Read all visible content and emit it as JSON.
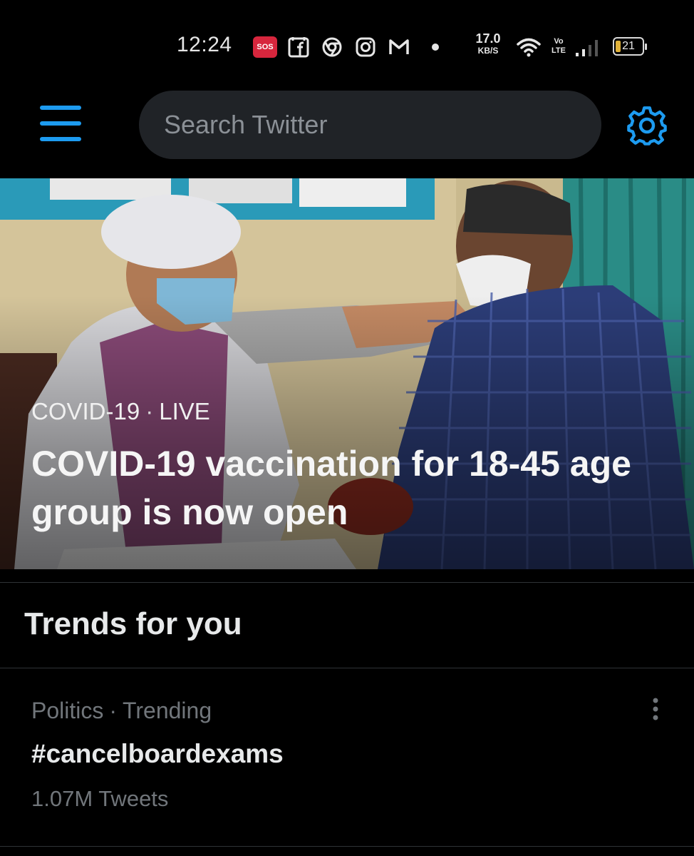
{
  "status_bar": {
    "time": "12:24",
    "sos": "SOS",
    "net_speed_value": "17.0",
    "net_speed_unit": "KB/S",
    "volte_top": "Vo",
    "volte_bottom": "LTE",
    "battery": "21",
    "icons": [
      "sos-icon",
      "facebook-icon",
      "chrome-icon",
      "instagram-icon",
      "gmail-icon",
      "dot-icon",
      "wifi-icon",
      "volte-icon",
      "signal-icon",
      "battery-icon"
    ]
  },
  "header": {
    "search_placeholder": "Search Twitter",
    "menu_icon": "hamburger-menu-icon",
    "settings_icon": "gear-icon",
    "accent_color": "#1d9bf0"
  },
  "hero": {
    "category": "COVID-19",
    "separator": "·",
    "live_label": "LIVE",
    "title": "COVID-19 vaccination for 18-45 age group is now open"
  },
  "trends": {
    "heading": "Trends for you",
    "items": [
      {
        "category": "Politics",
        "separator": "·",
        "status": "Trending",
        "name": "#cancelboardexams",
        "count": "1.07M Tweets"
      }
    ]
  }
}
